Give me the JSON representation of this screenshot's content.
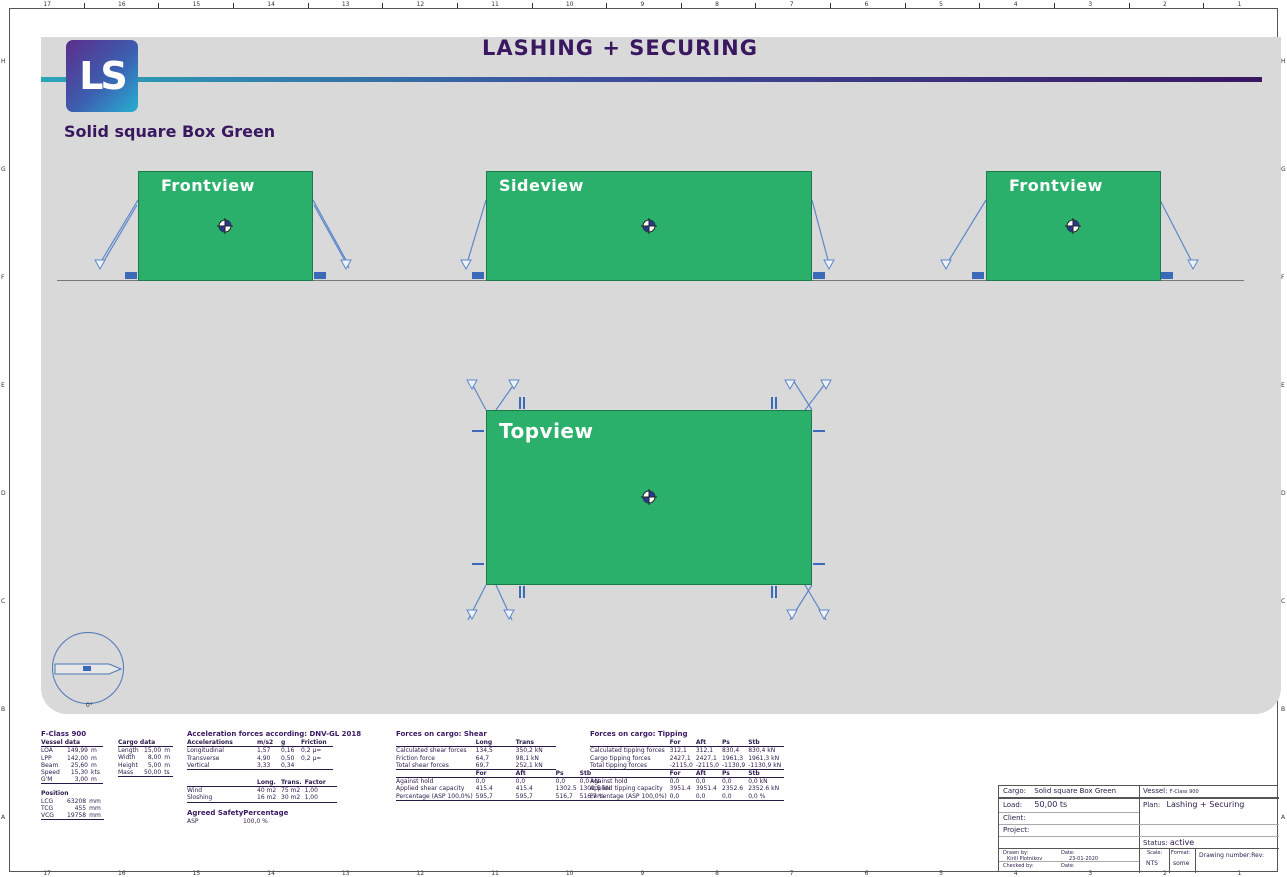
{
  "ruler": {
    "top": [
      "17",
      "16",
      "15",
      "14",
      "13",
      "12",
      "11",
      "10",
      "9",
      "8",
      "7",
      "6",
      "5",
      "4",
      "3",
      "2",
      "1"
    ],
    "left": [
      "H",
      "G",
      "F",
      "E",
      "D",
      "C",
      "B",
      "A"
    ]
  },
  "title": "LASHING + SECURING",
  "logo_text": "LS",
  "cargo_name": "Solid square Box Green",
  "views": {
    "front_left": "Frontview",
    "side": "Sideview",
    "front_right": "Frontview",
    "top": "Topview"
  },
  "compass_label": "0°",
  "vessel": {
    "title": "F-Class 900",
    "header": "Vessel data",
    "rows": [
      {
        "k": "LOA",
        "v": "149,99",
        "u": "m"
      },
      {
        "k": "LPP",
        "v": "142,00",
        "u": "m"
      },
      {
        "k": "Beam",
        "v": "25,60",
        "u": "m"
      },
      {
        "k": "Speed",
        "v": "15,30",
        "u": "kts"
      },
      {
        "k": "G'M",
        "v": "3,00",
        "u": "m"
      }
    ],
    "position_header": "Position",
    "position": [
      {
        "k": "LCG",
        "v": "63208",
        "u": "mm"
      },
      {
        "k": "TCG",
        "v": "455",
        "u": "mm"
      },
      {
        "k": "VCG",
        "v": "19758",
        "u": "mm"
      }
    ]
  },
  "cargo_data": {
    "header": "Cargo data",
    "rows": [
      {
        "k": "Length",
        "v": "15,00",
        "u": "m"
      },
      {
        "k": "Width",
        "v": "8,00",
        "u": "m"
      },
      {
        "k": "Height",
        "v": "5,00",
        "u": "m"
      },
      {
        "k": "Mass",
        "v": "50,00",
        "u": "ts"
      }
    ]
  },
  "acceleration": {
    "title": "Acceleration forces according: DNV-GL 2018",
    "headers": [
      "Accelerations",
      "m/s2",
      "g",
      "Friction"
    ],
    "rows": [
      [
        "Longitudinal",
        "1,57",
        "0,16",
        "0,2 μ="
      ],
      [
        "Transverse",
        "4,90",
        "0,50",
        "0,2 μ="
      ],
      [
        "Vertical",
        "3,33",
        "0,34",
        ""
      ]
    ],
    "wind_headers": [
      "",
      "Long.",
      "Trans.",
      "Factor"
    ],
    "wind_rows": [
      [
        "Wind",
        "40 m2",
        "75 m2",
        "1,00"
      ],
      [
        "Sloshing",
        "16 m2",
        "30 m2",
        "1,00"
      ]
    ],
    "asp_title": "Agreed SafetyPercentage",
    "asp_label": "ASP",
    "asp_value": "100,0 %"
  },
  "shear": {
    "title": "Forces on cargo: Shear",
    "headers": [
      "",
      "Long",
      "Trans"
    ],
    "rows": [
      [
        "Calculated shear forces",
        "134,5",
        "350,2 kN"
      ],
      [
        "Friction force",
        "64,7",
        "98,1 kN"
      ],
      [
        "Total shear forces",
        "69,7",
        "252,1 kN"
      ]
    ],
    "headers2": [
      "",
      "For",
      "Aft",
      "Ps",
      "Stb"
    ],
    "rows2": [
      [
        "Against hold",
        "0,0",
        "0,0",
        "0,0",
        "0,0 kN"
      ],
      [
        "Applied shear capacity",
        "415.4",
        "415.4",
        "1302.5",
        "1302.5 kN"
      ],
      [
        "Percentage (ASP 100,0%)",
        "595,7",
        "595,7",
        "516,7",
        "516,7 %"
      ]
    ]
  },
  "tipping": {
    "title": "Forces on cargo: Tipping",
    "headers": [
      "",
      "For",
      "Aft",
      "Ps",
      "Stb"
    ],
    "rows": [
      [
        "Calculated tipping forces",
        "312,1",
        "312,1",
        "830,4",
        "830,4 kN"
      ],
      [
        "Cargo tipping forces",
        "2427,1",
        "2427,1",
        "1961,3",
        "1961,3 kN"
      ],
      [
        "Total tipping forces",
        "-2115,0",
        "-2115,0",
        "-1130,9",
        "-1130,9 kN"
      ]
    ],
    "rows2": [
      [
        "Against hold",
        "0,0",
        "0,0",
        "0,0",
        "0,0 kN"
      ],
      [
        "Applied tipping capacity",
        "3951.4",
        "3951.4",
        "2352.6",
        "2352.6 kN"
      ],
      [
        "Percentage (ASP 100,0%)",
        "0,0",
        "0,0",
        "0,0",
        "0,0 %"
      ]
    ]
  },
  "title_block": {
    "cargo_label": "Cargo:",
    "cargo_value": "Solid square Box Green",
    "vessel_label": "Vessel:",
    "vessel_value": "F-Class 900",
    "load_label": "Load:",
    "load_value": "50,00 ts",
    "plan_label": "Plan:",
    "plan_value": "Lashing + Securing",
    "client_label": "Client:",
    "project_label": "Project:",
    "status_label": "Status:",
    "status_value": "active",
    "drawn_label": "Drawn by:",
    "drawn_value": "Kirill Plotnikov",
    "date_label": "Date:",
    "date_value": "23-01-2020",
    "checked_label": "Checked by:",
    "date2_label": "Date:",
    "scale_label": "Scale:",
    "scale_value": "NTS",
    "format_label": "Format:",
    "format_value": "some",
    "drawing_number_label": "Drawing number:",
    "rev_label": "Rev:"
  },
  "colors": {
    "cargo": "#2bb06c",
    "background": "#d9d9d9",
    "lashing": "#5d87c8",
    "title": "#3a1860"
  }
}
